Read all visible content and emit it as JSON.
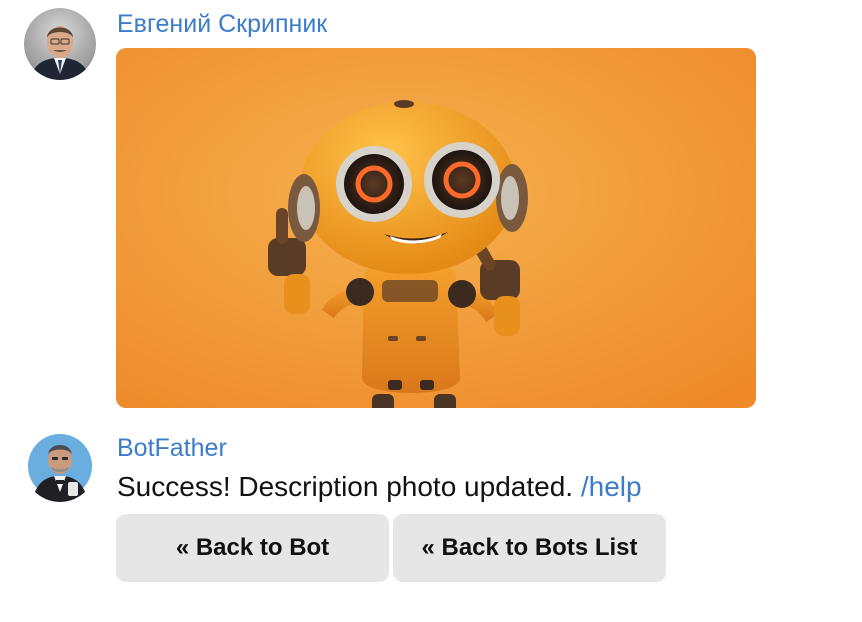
{
  "messages": [
    {
      "sender": "Евгений Скрипник",
      "avatar": "user-photo-avatar",
      "attachment": "robot-thumbs-up-photo"
    },
    {
      "sender": "BotFather",
      "avatar": "botfather-avatar",
      "text": "Success! Description photo updated.",
      "command": "/help"
    }
  ],
  "keyboard": {
    "back_to_bot": "« Back to Bot",
    "back_to_bots_list": "« Back to Bots List"
  },
  "colors": {
    "accent": "#3d7cc9",
    "button_bg": "#e6e6e6",
    "photo_bg": "#f2a23c"
  }
}
